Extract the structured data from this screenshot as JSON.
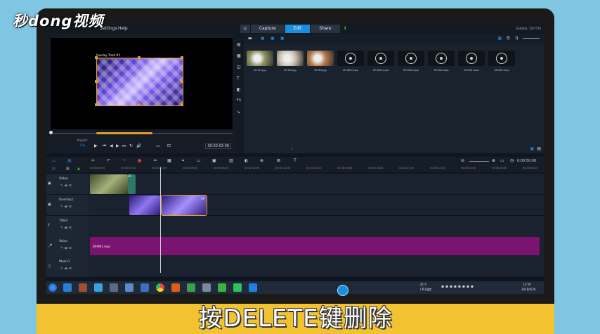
{
  "watermark": "秒dong视频",
  "menu": {
    "settings": "Settings",
    "help": "Help"
  },
  "tabs": {
    "capture": "Capture",
    "edit": "Edit",
    "share": "Share"
  },
  "project_name": "Untitled, 720*576",
  "preview": {
    "overlay_label": "Overlay Track #1",
    "project_label": "Project-",
    "clip_label": "Clip-",
    "timecode": "00:00:02:08"
  },
  "library": {
    "items": [
      {
        "label": "SP-I01.jpg",
        "kind": "image",
        "color": "#8a8f5e"
      },
      {
        "label": "SP-I02.jpg",
        "kind": "image",
        "color": "#c9c2ad"
      },
      {
        "label": "SP-I03.jpg",
        "kind": "image",
        "color": "#b77a4e"
      },
      {
        "label": "SP-M01.mpa",
        "kind": "audio"
      },
      {
        "label": "SP-M02.mpa",
        "kind": "audio"
      },
      {
        "label": "SP-M03.mpa",
        "kind": "audio"
      },
      {
        "label": "SP-S01.mpa",
        "kind": "audio"
      },
      {
        "label": "SP-S02.mpa",
        "kind": "audio"
      },
      {
        "label": "SP-S03.mpa",
        "kind": "audio"
      }
    ]
  },
  "timeline": {
    "timecode": "0:00:50:00",
    "ruler": [
      "00:00:00:00",
      "00:00:02:00",
      "00:00:04:00",
      "00:00:06:00",
      "00:00:08:00",
      "00:00:10:00",
      "00:00:12:00",
      "00:00:14:00",
      "00:00:16:00",
      "00:00:18:00",
      "00:00:20:00",
      "00:00:22:00",
      "00:00:24:00",
      "00:00:26:00",
      "00:00:28:00"
    ],
    "tracks": [
      {
        "name": "Video",
        "icon": "▣"
      },
      {
        "name": "Overlay1",
        "icon": "▣"
      },
      {
        "name": "Title1",
        "icon": "T"
      },
      {
        "name": "Voice",
        "icon": "🎤"
      },
      {
        "name": "Music1",
        "icon": "♫"
      }
    ],
    "video_clip_tag": "SP",
    "overlay_clip_tag": "SP",
    "voice_clip": "SP-M01.mpa"
  },
  "taskbar": {
    "temperature": "41℃",
    "cpu_temp": "CPU温度",
    "time": "13:59",
    "date": "2018/9/26"
  },
  "caption": "按DELETE键删除",
  "colors": {
    "accent": "#1a8fe0",
    "voice_clip": "#7a1470",
    "banner": "#f2c230",
    "selection": "#f09a1c"
  }
}
